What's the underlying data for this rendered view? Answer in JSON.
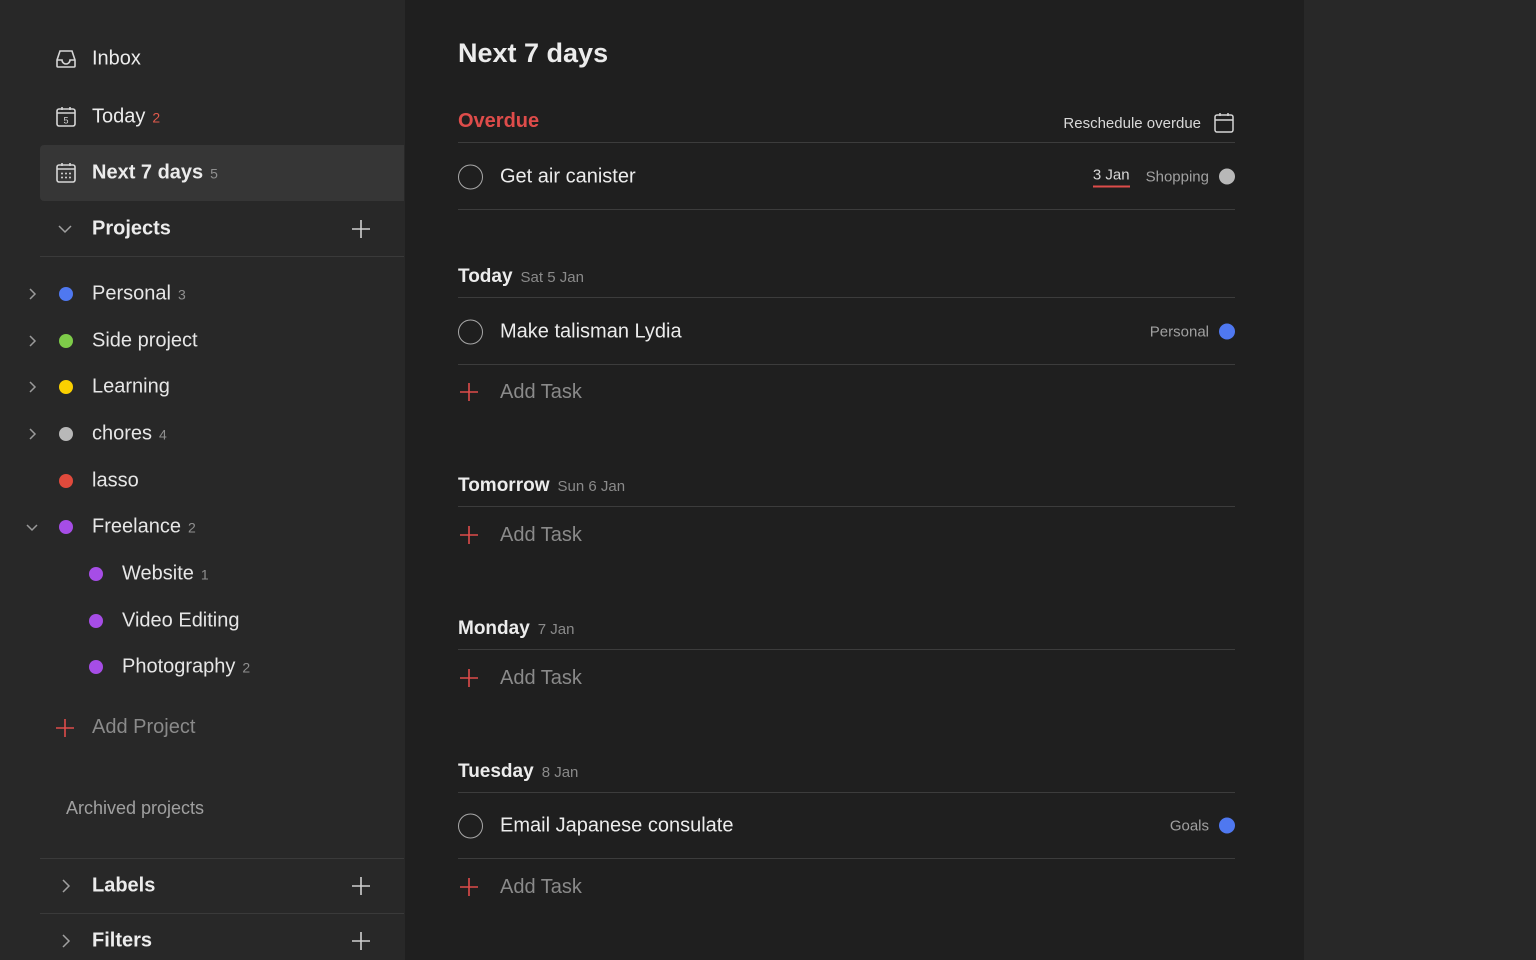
{
  "colors": {
    "accent_red": "#de4c4a",
    "blue": "#4f78f0",
    "green": "#7ecc49",
    "yellow": "#fad000",
    "grey": "#b8b8b8",
    "red": "#e04a3c",
    "purple": "#a64de6"
  },
  "sidebar": {
    "nav": [
      {
        "label": "Inbox",
        "count": "",
        "icon": "inbox-icon"
      },
      {
        "label": "Today",
        "count": "2",
        "icon": "calendar-today-icon",
        "day_number": "5"
      },
      {
        "label": "Next 7 days",
        "count": "5",
        "icon": "calendar-week-icon"
      }
    ],
    "projects_header": "Projects",
    "projects": [
      {
        "name": "Personal",
        "count": "3",
        "color": "#4f78f0"
      },
      {
        "name": "Side project",
        "count": "",
        "color": "#7ecc49"
      },
      {
        "name": "Learning",
        "count": "",
        "color": "#fad000"
      },
      {
        "name": "chores",
        "count": "4",
        "color": "#b8b8b8"
      },
      {
        "name": "lasso",
        "count": "",
        "color": "#e04a3c"
      },
      {
        "name": "Freelance",
        "count": "2",
        "color": "#a64de6"
      },
      {
        "name": "Website",
        "count": "1",
        "color": "#a64de6"
      },
      {
        "name": "Video Editing",
        "count": "",
        "color": "#a64de6"
      },
      {
        "name": "Photography",
        "count": "2",
        "color": "#a64de6"
      }
    ],
    "add_project": "Add Project",
    "archived": "Archived projects",
    "labels_header": "Labels",
    "filters_header": "Filters"
  },
  "main": {
    "title": "Next 7 days",
    "overdue": {
      "title": "Overdue",
      "reschedule": "Reschedule overdue",
      "tasks": [
        {
          "content": "Get air canister",
          "due": "3 Jan",
          "project": "Shopping",
          "color": "#b8b8b8"
        }
      ]
    },
    "days": [
      {
        "title": "Today",
        "sub": "Sat 5 Jan",
        "tasks": [
          {
            "content": "Make talisman Lydia",
            "project": "Personal",
            "color": "#4f78f0"
          }
        ]
      },
      {
        "title": "Tomorrow",
        "sub": "Sun 6 Jan",
        "tasks": []
      },
      {
        "title": "Monday",
        "sub": "7 Jan",
        "tasks": []
      },
      {
        "title": "Tuesday",
        "sub": "8 Jan",
        "tasks": [
          {
            "content": "Email Japanese consulate",
            "project": "Goals",
            "color": "#4f78f0"
          }
        ]
      }
    ],
    "add_task": "Add Task"
  }
}
